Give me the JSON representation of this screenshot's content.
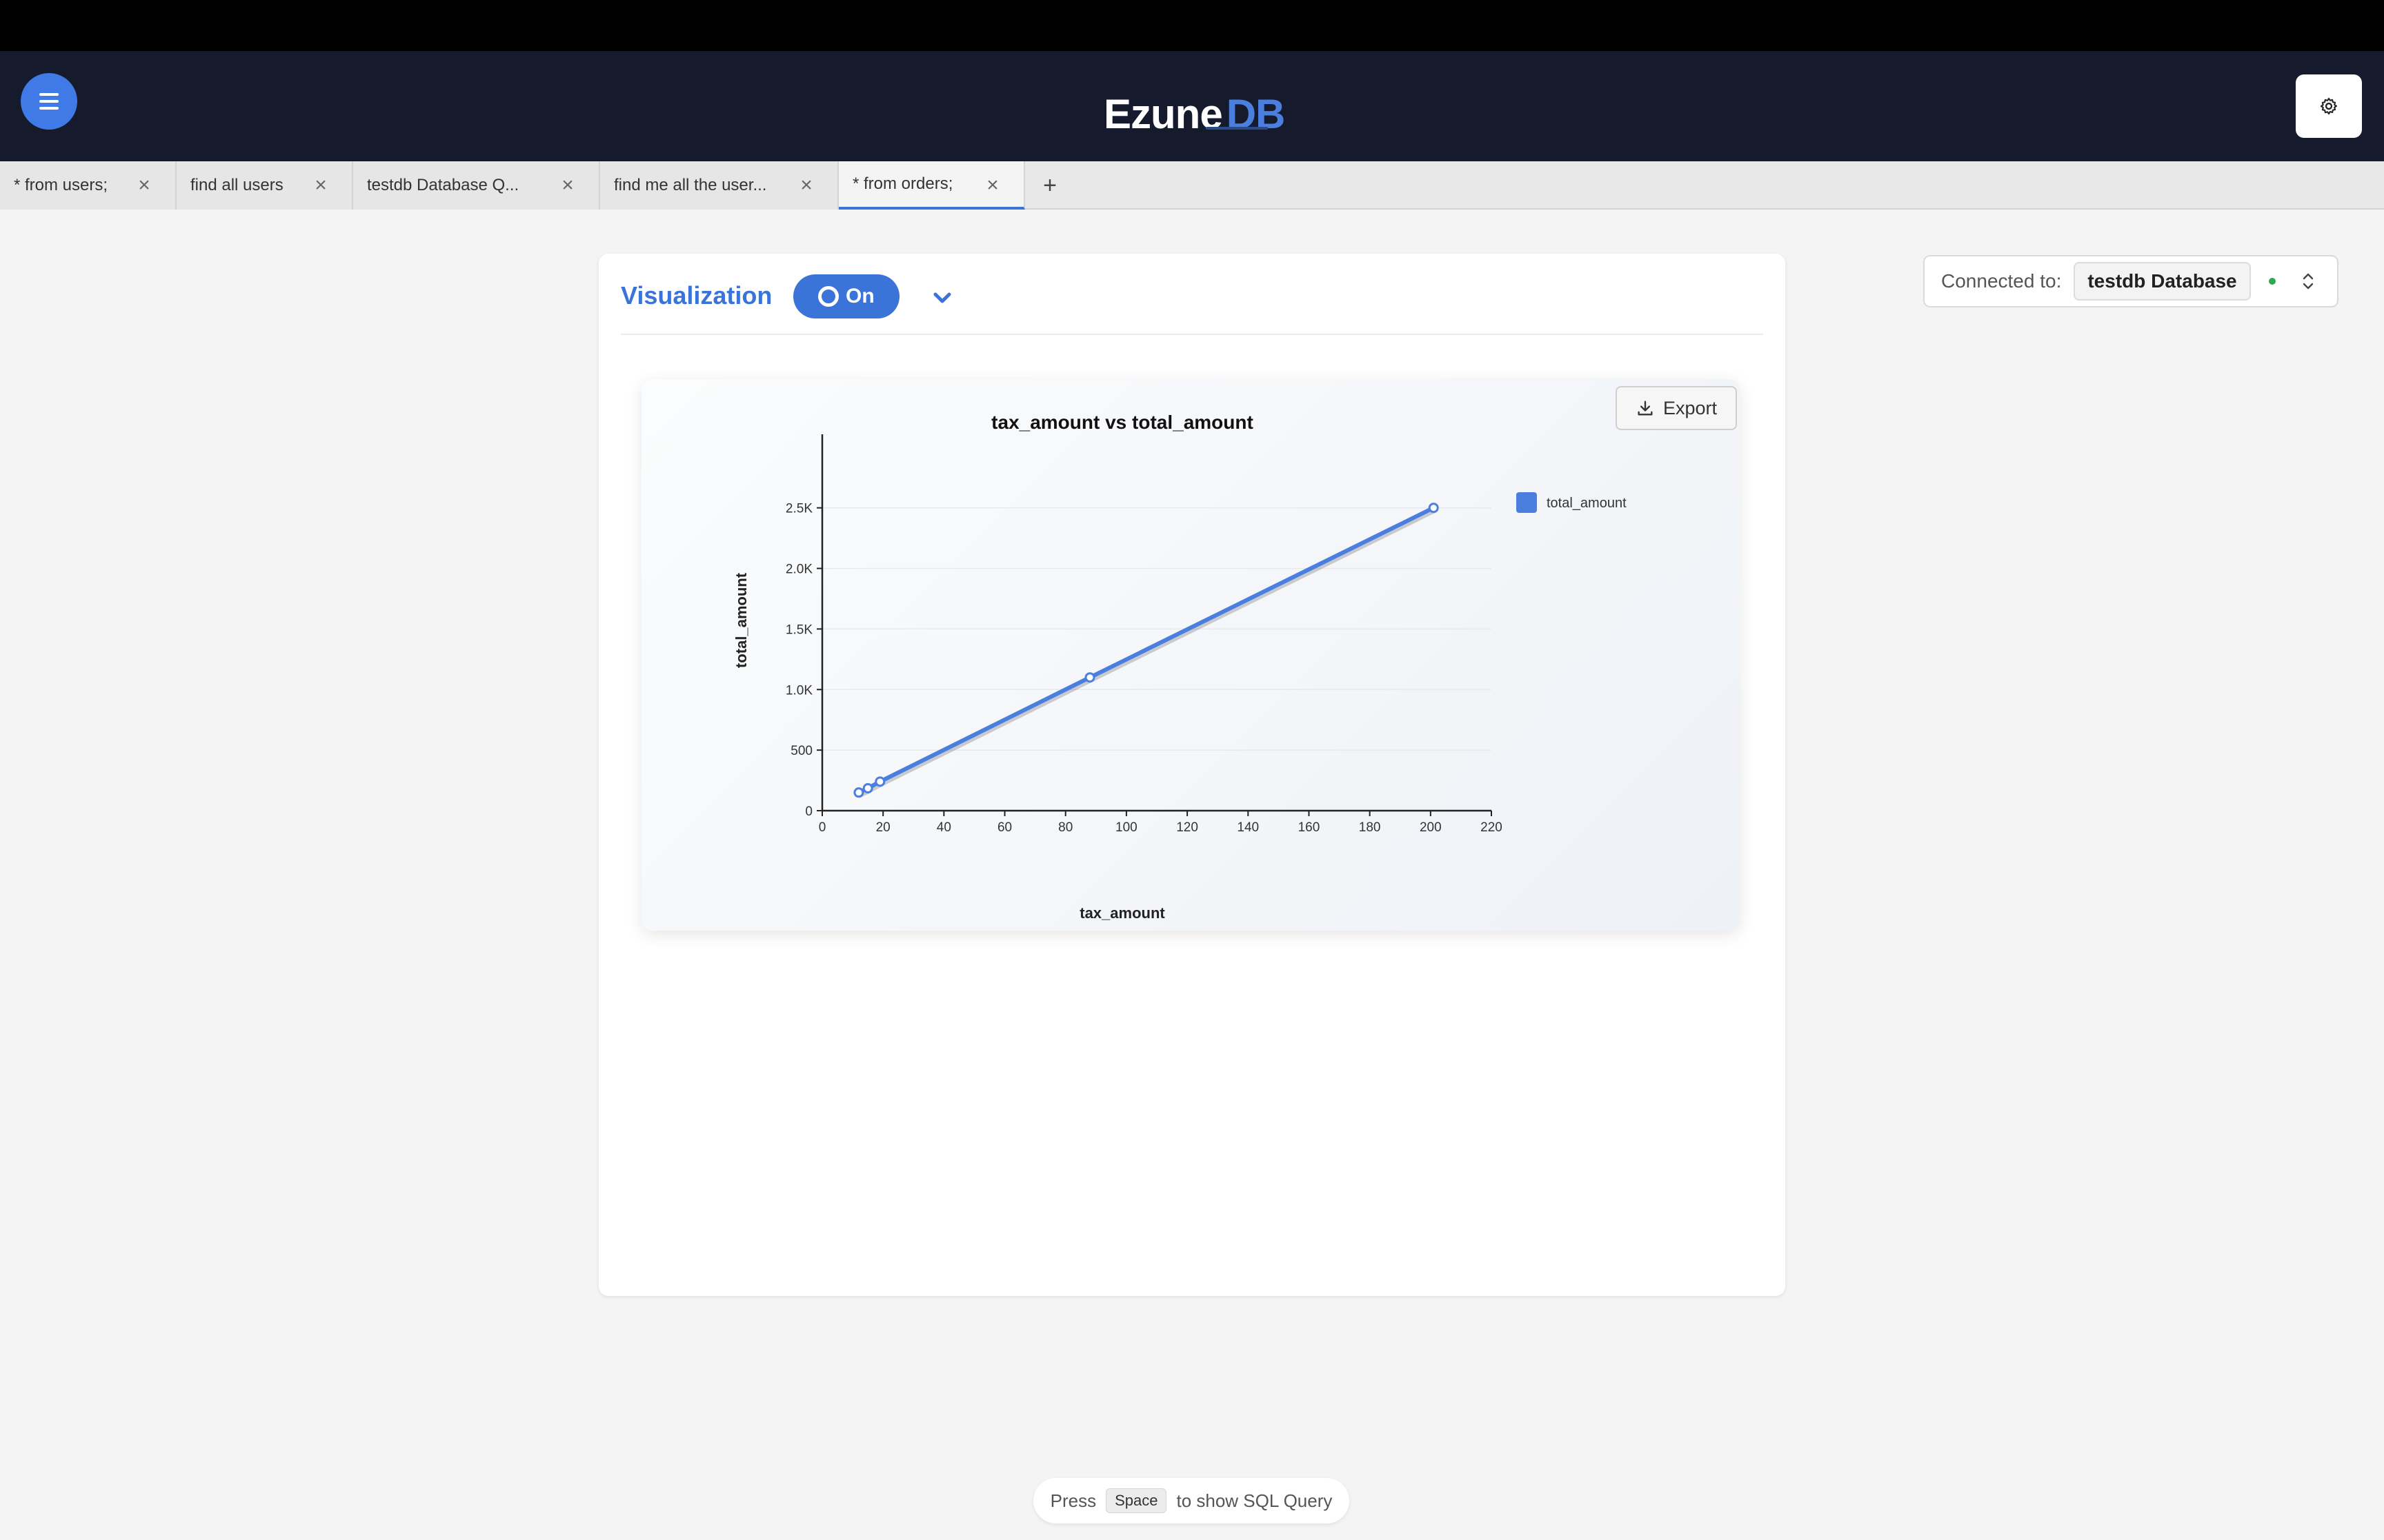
{
  "app": {
    "logo_part1": "Ezune",
    "logo_part2": "DB",
    "menu_icon": "hamburger-icon",
    "settings_icon": "gear-icon"
  },
  "tabs": [
    {
      "label": "* from users;",
      "active": false
    },
    {
      "label": "find all users",
      "active": false
    },
    {
      "label": "testdb Database Q...",
      "active": false
    },
    {
      "label": "find me all the user...",
      "active": false
    },
    {
      "label": "* from orders;",
      "active": true
    }
  ],
  "tab_add_label": "+",
  "panel": {
    "title": "Visualization",
    "toggle_label": "On",
    "export_label": "Export"
  },
  "connection": {
    "label": "Connected to:",
    "database": "testdb Database"
  },
  "hint": {
    "before": "Press",
    "key": "Space",
    "after": "to show SQL Query"
  },
  "colors": {
    "accent": "#3a74d8",
    "header_bg": "#151a2d",
    "series": "#4a7fe0",
    "status_ok": "#2fa84f"
  },
  "chart_data": {
    "type": "line",
    "title": "tax_amount vs total_amount",
    "xlabel": "tax_amount",
    "ylabel": "total_amount",
    "xlim": [
      0,
      220
    ],
    "ylim": [
      0,
      2800
    ],
    "x_ticks": [
      0,
      20,
      40,
      60,
      80,
      100,
      120,
      140,
      160,
      180,
      200,
      220
    ],
    "y_ticks": [
      0,
      500,
      1000,
      1500,
      2000,
      2500
    ],
    "y_tick_labels": [
      "0",
      "500",
      "1.0K",
      "1.5K",
      "2.0K",
      "2.5K"
    ],
    "legend_position": "top-right",
    "grid": true,
    "series": [
      {
        "name": "total_amount",
        "x": [
          12,
          15,
          19,
          88,
          201
        ],
        "y": [
          150,
          185,
          240,
          1100,
          2500
        ]
      }
    ]
  }
}
